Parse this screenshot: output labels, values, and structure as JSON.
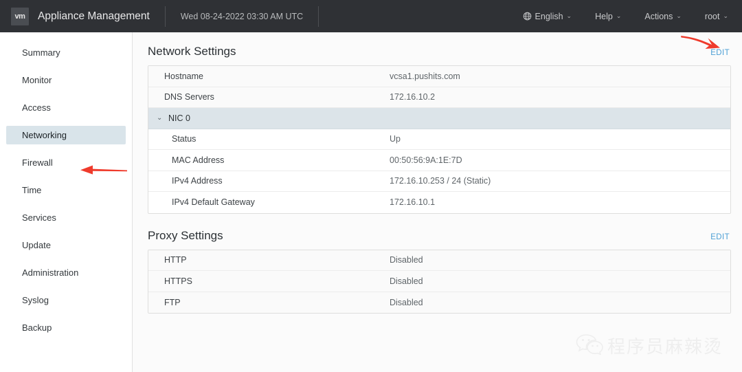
{
  "header": {
    "logo_text": "vm",
    "app_title": "Appliance Management",
    "timestamp": "Wed 08-24-2022 03:30 AM UTC",
    "menus": [
      {
        "label": "English",
        "caret": "⌄",
        "icon": "globe-icon"
      },
      {
        "label": "Help",
        "caret": "⌄"
      },
      {
        "label": "Actions",
        "caret": "⌄"
      },
      {
        "label": "root",
        "caret": "⌄"
      }
    ]
  },
  "sidebar": {
    "items": [
      {
        "label": "Summary",
        "active": false
      },
      {
        "label": "Monitor",
        "active": false
      },
      {
        "label": "Access",
        "active": false
      },
      {
        "label": "Networking",
        "active": true
      },
      {
        "label": "Firewall",
        "active": false
      },
      {
        "label": "Time",
        "active": false
      },
      {
        "label": "Services",
        "active": false
      },
      {
        "label": "Update",
        "active": false
      },
      {
        "label": "Administration",
        "active": false
      },
      {
        "label": "Syslog",
        "active": false
      },
      {
        "label": "Backup",
        "active": false
      }
    ]
  },
  "network_settings": {
    "title": "Network Settings",
    "edit_label": "EDIT",
    "rows": [
      {
        "label": "Hostname",
        "value": "vcsa1.pushits.com"
      },
      {
        "label": "DNS Servers",
        "value": "172.16.10.2"
      }
    ],
    "group": {
      "label": "NIC 0",
      "chevron": "⌄",
      "rows": [
        {
          "label": "Status",
          "value": "Up"
        },
        {
          "label": "MAC Address",
          "value": "00:50:56:9A:1E:7D"
        },
        {
          "label": "IPv4 Address",
          "value": "172.16.10.253 / 24 (Static)"
        },
        {
          "label": "IPv4 Default Gateway",
          "value": "172.16.10.1"
        }
      ]
    }
  },
  "proxy_settings": {
    "title": "Proxy Settings",
    "edit_label": "EDIT",
    "rows": [
      {
        "label": "HTTP",
        "value": "Disabled"
      },
      {
        "label": "HTTPS",
        "value": "Disabled"
      },
      {
        "label": "FTP",
        "value": "Disabled"
      }
    ]
  },
  "watermark": {
    "text": "程序员麻辣烫"
  },
  "colors": {
    "topbar_bg": "#2f3135",
    "accent_link": "#4b9fd5",
    "active_nav_bg": "#d9e4ea",
    "group_row_bg": "#dce4e9",
    "annotation_red": "#ef3b2c"
  }
}
